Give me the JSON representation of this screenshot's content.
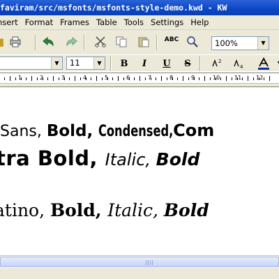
{
  "window": {
    "title": "faviram/src/msfonts/msfonts-style-demo.kwd - KW"
  },
  "menubar": {
    "items": [
      "nsert",
      "Format",
      "Frames",
      "Table",
      "Tools",
      "Settings",
      "Help"
    ]
  },
  "toolbar": {
    "zoom_value": "100%",
    "icons": [
      "open-icon",
      "print-icon",
      "undo-icon",
      "redo-icon",
      "cut-icon",
      "copy-icon",
      "paste-icon",
      "spellcheck-icon",
      "find-icon"
    ]
  },
  "format_bar": {
    "font_value": "",
    "size_value": "11",
    "bold": "B",
    "italic": "I",
    "underline": "U",
    "strike": "S"
  },
  "ruler": {
    "numbers": [
      "1",
      "2",
      "3",
      "4",
      "5",
      "6",
      "7",
      "8",
      "9",
      "10",
      "11",
      "12"
    ]
  },
  "document": {
    "line1": {
      "a": "Sans, ",
      "b": "Bold, ",
      "c": "Condensed, ",
      "d": "Com"
    },
    "line2": {
      "a": "tra Bold, ",
      "b": "Italic, ",
      "c": "Bold"
    },
    "line3": {
      "a": "atino, ",
      "b": "Bold, ",
      "c": "Italic, ",
      "d": "Bold"
    }
  },
  "colors": {
    "titlebar": "#0b46c4",
    "chrome": "#ece9d8",
    "accent_font_color": "#0a2ea0"
  }
}
